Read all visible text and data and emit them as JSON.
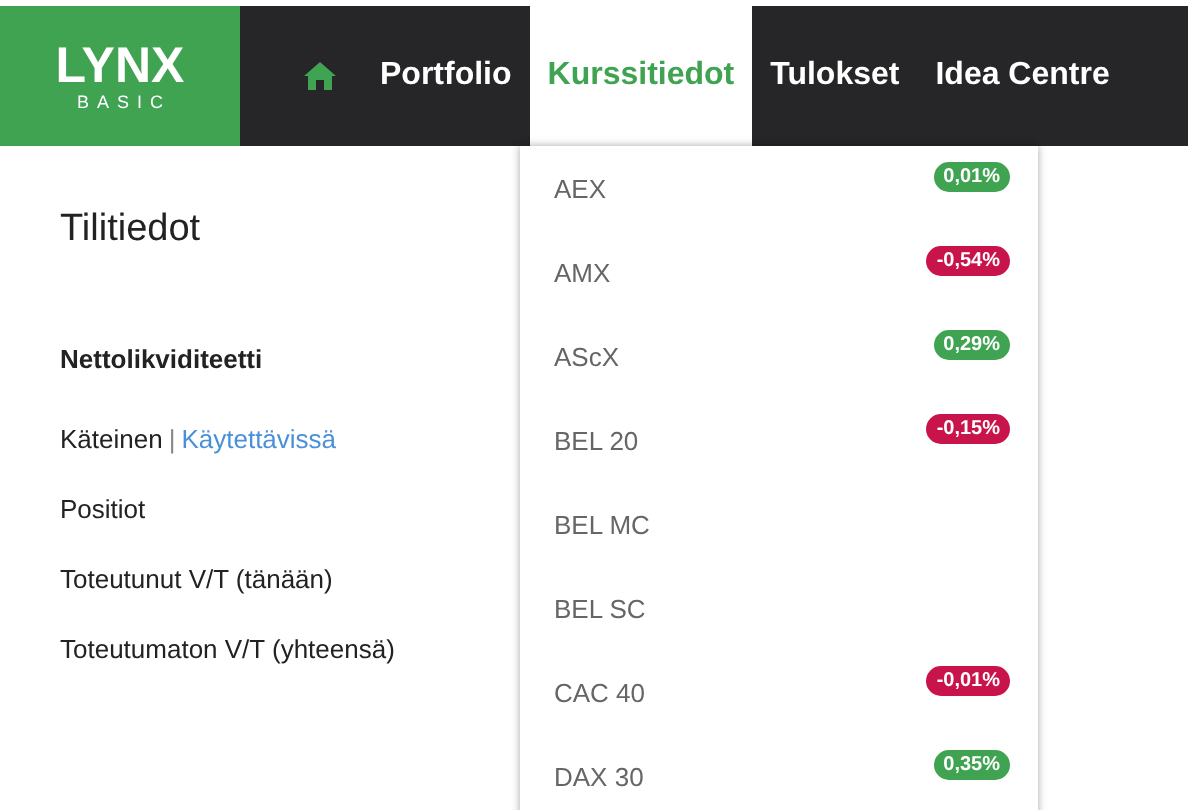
{
  "logo": {
    "name": "LYNX",
    "sub": "BASIC"
  },
  "nav": [
    {
      "label": "Portfolio",
      "selected": false
    },
    {
      "label": "Kurssitiedot",
      "selected": true
    },
    {
      "label": "Tulokset",
      "selected": false
    },
    {
      "label": "Idea Centre",
      "selected": false
    }
  ],
  "account": {
    "title": "Tilitiedot",
    "heading": "Nettolikviditeetti",
    "cash": "Käteinen",
    "separator": "|",
    "available_link": "Käytettävissä",
    "rows": [
      "Positiot",
      "Toteutunut V/T (tänään)",
      "Toteutumaton V/T (yhteensä)"
    ]
  },
  "indices": [
    {
      "name": "AEX",
      "change": "0,01%",
      "color": "#3fa351"
    },
    {
      "name": "AMX",
      "change": "-0,54%",
      "color": "#c8144b"
    },
    {
      "name": "AScX",
      "change": "0,29%",
      "color": "#3fa351"
    },
    {
      "name": "BEL 20",
      "change": "-0,15%",
      "color": "#c8144b"
    },
    {
      "name": "BEL MC"
    },
    {
      "name": "BEL SC"
    },
    {
      "name": "CAC 40",
      "change": "-0,01%",
      "color": "#c8144b"
    },
    {
      "name": "DAX 30",
      "change": "0,35%",
      "color": "#3fa351"
    }
  ]
}
